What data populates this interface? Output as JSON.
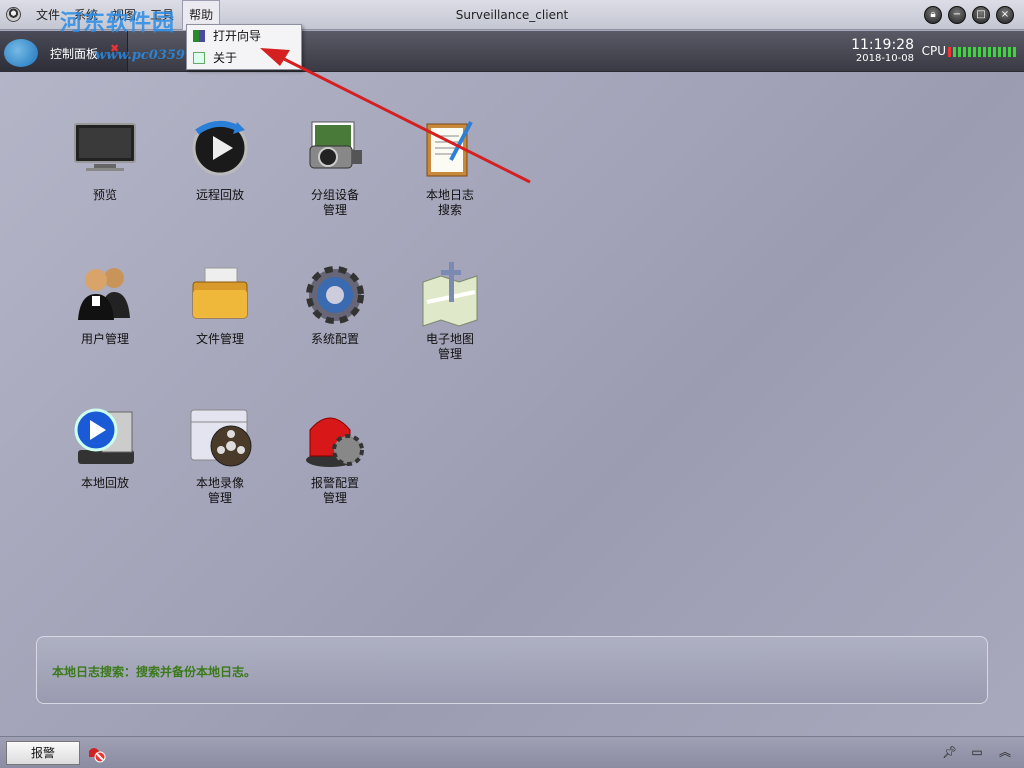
{
  "window": {
    "title": "Surveillance_client",
    "menu": [
      "文件",
      "系统",
      "视图",
      "工具",
      "帮助"
    ],
    "controls": [
      "lock-icon",
      "minimize-icon",
      "restore-icon",
      "close-icon"
    ]
  },
  "toolbar": {
    "tab_label": "控制面板",
    "tab_close": "✖",
    "watermark_brand": "河东软件园",
    "watermark_url": "www.pc0359.cn",
    "time": "11:19:28",
    "date": "2018-10-08",
    "cpu_label": "CPU"
  },
  "help_menu": {
    "items": [
      "打开向导",
      "关于"
    ]
  },
  "tiles": [
    {
      "label": "预览",
      "icon": "monitor-icon"
    },
    {
      "label": "远程回放",
      "icon": "remote-playback-icon"
    },
    {
      "label": "分组设备\n管理",
      "label1": "分组设备",
      "label2": "管理",
      "icon": "camera-group-icon"
    },
    {
      "label1": "本地日志",
      "label2": "搜索",
      "icon": "log-search-icon"
    },
    {
      "label": "用户管理",
      "icon": "users-icon"
    },
    {
      "label": "文件管理",
      "icon": "folder-icon"
    },
    {
      "label": "系统配置",
      "icon": "gear-icon"
    },
    {
      "label1": "电子地图",
      "label2": "管理",
      "icon": "map-icon"
    },
    {
      "label": "本地回放",
      "icon": "local-playback-icon"
    },
    {
      "label1": "本地录像",
      "label2": "管理",
      "icon": "film-reel-icon"
    },
    {
      "label1": "报警配置",
      "label2": "管理",
      "icon": "alarm-siren-icon"
    }
  ],
  "info": {
    "text": "本地日志搜索：搜索并备份本地日志。"
  },
  "statusbar": {
    "alarm_label": "报警"
  },
  "colors": {
    "accent_green": "#3a7a1a",
    "annotation_arrow": "#d42020"
  }
}
